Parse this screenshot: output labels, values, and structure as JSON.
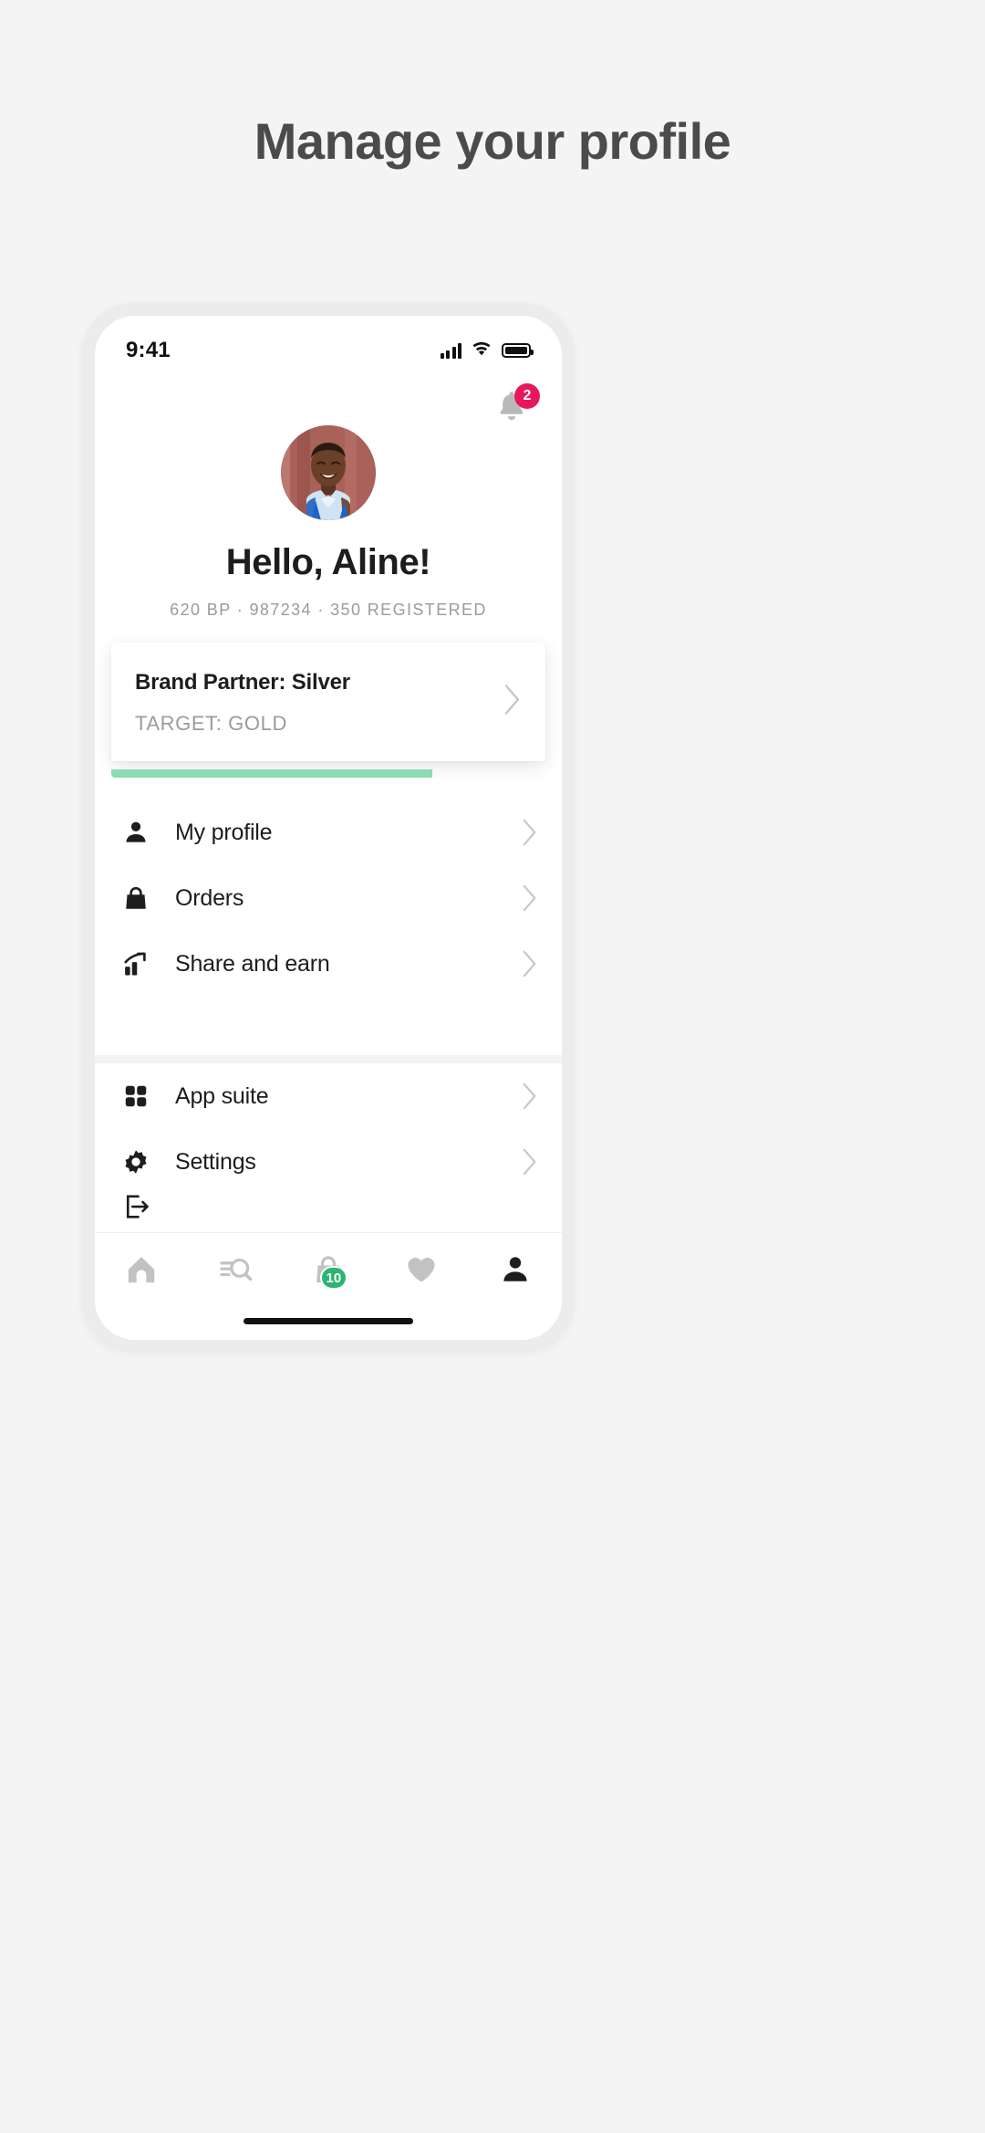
{
  "page": {
    "title": "Manage your profile",
    "background_color": "#f4f4f4",
    "title_color": "#4b4b4b"
  },
  "phone": {
    "status_bar": {
      "time": "9:41",
      "icons": [
        "cellular-signal-icon",
        "wifi-icon",
        "battery-icon"
      ]
    },
    "notification": {
      "icon": "bell-icon",
      "badge_count": "2",
      "badge_color": "#e8175d"
    },
    "profile": {
      "avatar_alt": "user-avatar-photo",
      "avatar_bg": "#a9615a",
      "greeting": "Hello, Aline!",
      "stats": "620 BP · 987234 · 350 REGISTERED",
      "stats_color": "#9b9b9b"
    },
    "tier_card": {
      "title": "Brand Partner: Silver",
      "target": "TARGET: GOLD",
      "chevron": "chevron-right-icon",
      "progress_percent": 74,
      "progress_color": "#8bdcb2"
    },
    "menu_groups": [
      {
        "items": [
          {
            "icon": "person-icon",
            "label": "My profile",
            "chevron": "chevron-right-icon"
          },
          {
            "icon": "shopping-bag-icon",
            "label": "Orders",
            "chevron": "chevron-right-icon"
          },
          {
            "icon": "growth-chart-icon",
            "label": "Share and earn",
            "chevron": "chevron-right-icon"
          }
        ]
      },
      {
        "items": [
          {
            "icon": "app-grid-icon",
            "label": "App suite",
            "chevron": "chevron-right-icon"
          },
          {
            "icon": "gear-icon",
            "label": "Settings",
            "chevron": "chevron-right-icon"
          }
        ]
      }
    ],
    "bottom_nav": {
      "items": [
        {
          "icon": "home-icon",
          "active": false
        },
        {
          "icon": "search-filter-icon",
          "active": false
        },
        {
          "icon": "shopping-bag-icon",
          "active": false,
          "badge": "10",
          "badge_color": "#2bb573"
        },
        {
          "icon": "heart-icon",
          "active": false
        },
        {
          "icon": "person-icon",
          "active": true
        }
      ]
    },
    "home_indicator": true
  }
}
